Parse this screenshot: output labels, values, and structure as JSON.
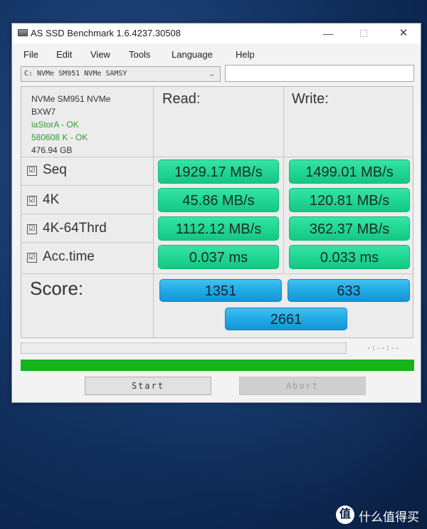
{
  "window": {
    "title": "AS SSD Benchmark 1.6.4237.30508",
    "controls": {
      "minimize": "—",
      "maximize": "☐",
      "close": "✕"
    }
  },
  "menu": [
    "File",
    "Edit",
    "View",
    "Tools",
    "Language",
    "Help"
  ],
  "drive_select": {
    "value": "C: NVMe SM951 NVMe SAMSY",
    "arrow": "⌄"
  },
  "drive_info": {
    "model": "NVMe SM951 NVMe",
    "firmware": "BXW7",
    "driver_status": "iaStorA - OK",
    "alignment_status": "580608 K - OK",
    "capacity": "476.94 GB"
  },
  "columns": {
    "read": "Read:",
    "write": "Write:"
  },
  "rows": [
    {
      "label": "Seq",
      "checked": true,
      "read": "1929.17 MB/s",
      "write": "1499.01 MB/s"
    },
    {
      "label": "4K",
      "checked": true,
      "read": "45.86 MB/s",
      "write": "120.81 MB/s"
    },
    {
      "label": "4K-64Thrd",
      "checked": true,
      "read": "1112.12 MB/s",
      "write": "362.37 MB/s"
    },
    {
      "label": "Acc.time",
      "checked": true,
      "read": "0.037 ms",
      "write": "0.033 ms"
    }
  ],
  "score": {
    "label": "Score:",
    "read": "1351",
    "write": "633",
    "total": "2661"
  },
  "progress": {
    "status": "-:--:--",
    "completion_fraction": 1.0
  },
  "buttons": {
    "start": "Start",
    "abort": "Abort"
  },
  "checkbox_glyph": "☑",
  "watermark": {
    "logo": "值",
    "text": "什么值得买"
  },
  "colors": {
    "value_bar": "#23d896",
    "score_bar": "#22a9e4",
    "progress_bar": "#14b41a",
    "ok_text": "#2e9a2e"
  }
}
